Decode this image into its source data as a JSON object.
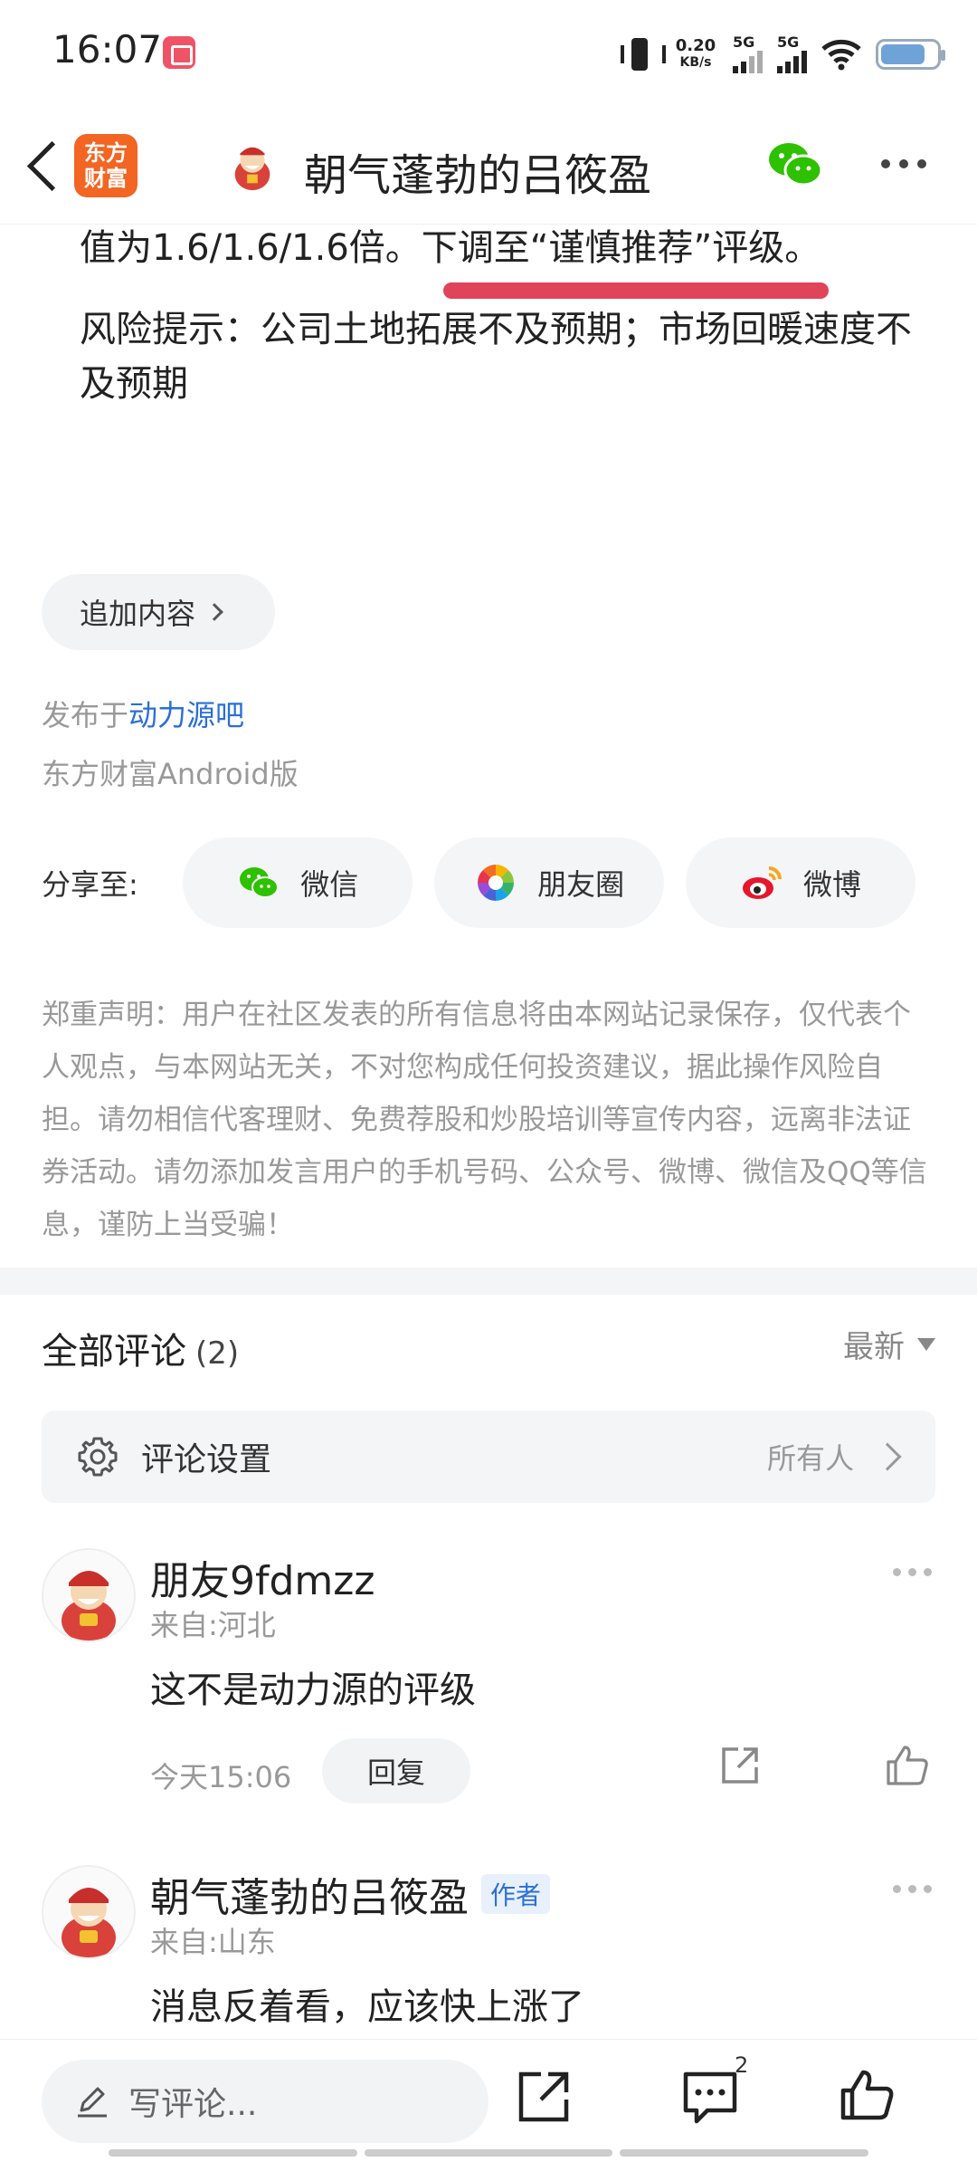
{
  "status_bar": {
    "time": "16:07",
    "net_speed_value": "0.20",
    "net_speed_unit": "KB/s",
    "sim1": "5G",
    "sim2": "5G"
  },
  "nav": {
    "brand_line1": "东方",
    "brand_line2": "财富",
    "title": "朝气蓬勃的吕筱盈"
  },
  "article": {
    "line1_before": "值为1.6/1.6/1.6倍。",
    "line1_highlight": "下调至“谨慎推荐”评级",
    "line1_after": "。",
    "risk": "风险提示：公司土地拓展不及预期；市场回暖速度不及预期"
  },
  "add_content_label": "追加内容",
  "published_prefix": "发布于",
  "published_forum": "动力源吧",
  "client_label": "东方财富Android版",
  "share": {
    "label": "分享至:",
    "wechat": "微信",
    "moments": "朋友圈",
    "weibo": "微博"
  },
  "disclaimer": "郑重声明：用户在社区发表的所有信息将由本网站记录保存，仅代表个人观点，与本网站无关，不对您构成任何投资建议，据此操作风险自担。请勿相信代客理财、免费荐股和炒股培训等宣传内容，远离非法证券活动。请勿添加发言用户的手机号码、公众号、微博、微信及QQ等信息，谨防上当受骗！",
  "comments": {
    "header": "全部评论",
    "count": "(2)",
    "sort": "最新",
    "settings_label": "评论设置",
    "settings_value": "所有人",
    "items": [
      {
        "name": "朋友9fdmzz",
        "location": "来自:河北",
        "text": "这不是动力源的评级",
        "time": "今天15:06",
        "reply": "回复"
      },
      {
        "name": "朝气蓬勃的吕筱盈",
        "badge": "作者",
        "location": "来自:山东",
        "text": "消息反着看，应该快上涨了"
      }
    ]
  },
  "bottom_bar": {
    "write_placeholder": "写评论...",
    "comment_count": "2"
  },
  "colors": {
    "brand_orange": "#f26522",
    "highlight_red": "#e0445a",
    "link_blue": "#2a6fd6",
    "wechat_green": "#2dc100"
  }
}
